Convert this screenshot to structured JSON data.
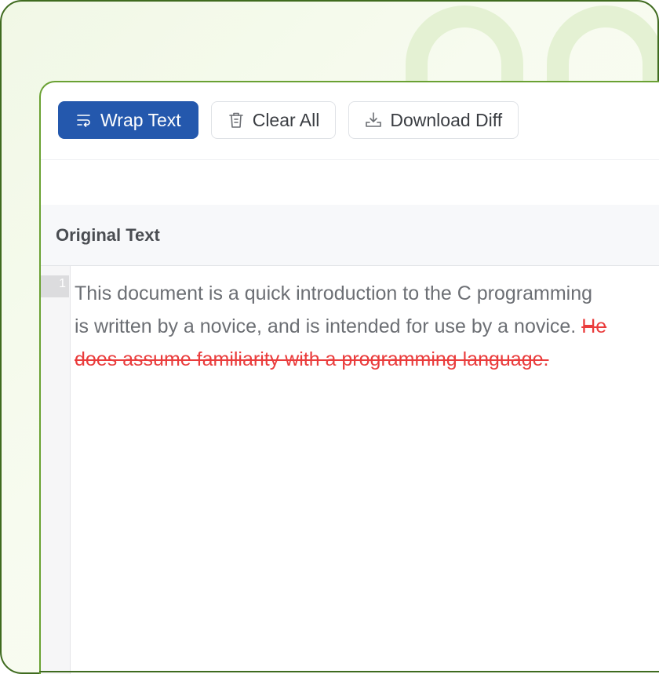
{
  "toolbar": {
    "wrap_label": "Wrap Text",
    "clear_label": "Clear All",
    "download_label": "Download Diff"
  },
  "pane": {
    "title": "Original Text",
    "line_number": "1",
    "lines": [
      "This document is a quick introduction to the C programming",
      "is written by a novice, and is intended for use by a novice. "
    ],
    "removed_line2": "He",
    "removed_line3": "does assume familiarity with a programming language."
  },
  "icons": {
    "wrap": "wrap-text-icon",
    "clear": "trash-icon",
    "download": "download-tray-icon"
  },
  "colors": {
    "accent": "#2458ad",
    "removed_text": "#ea3c3c",
    "frame_border": "#3f6b1f",
    "panel_border": "#6aa133"
  }
}
